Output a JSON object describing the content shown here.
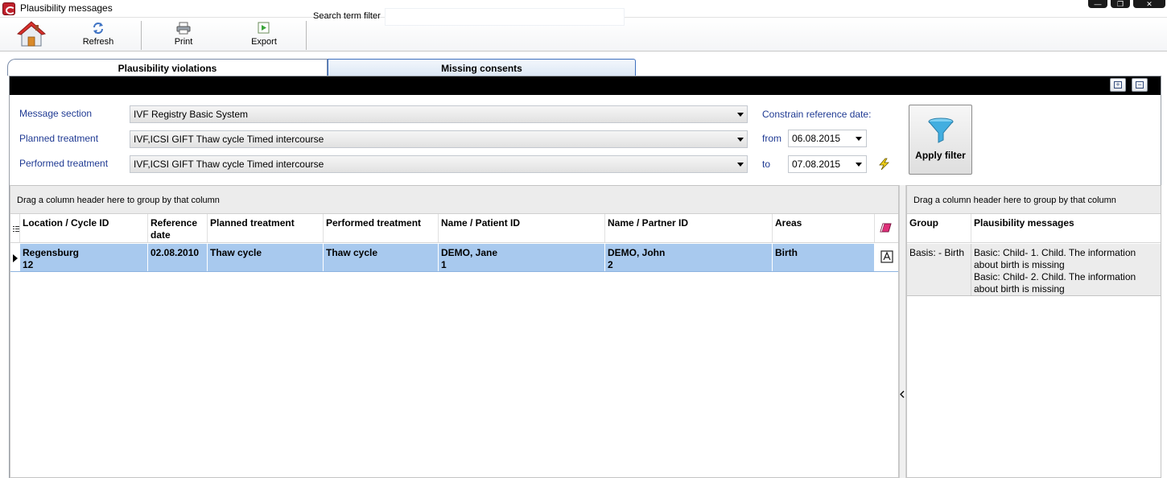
{
  "window": {
    "title": "Plausibility messages",
    "controls": [
      "—",
      "❐",
      "✕"
    ]
  },
  "toolbar": {
    "refresh_label": "Refresh",
    "print_label": "Print",
    "export_label": "Export",
    "search_label": "Search term filter",
    "search_value": ""
  },
  "tabs": [
    {
      "label": "Plausibility violations",
      "active": true
    },
    {
      "label": "Missing consents",
      "active": false
    }
  ],
  "panel": {
    "expand_symbol": "+",
    "collapse_symbol": "−"
  },
  "filters": {
    "message_section_label": "Message section",
    "message_section_value": "IVF Registry Basic System",
    "planned_label": "Planned treatment",
    "planned_value": "IVF,ICSI GIFT Thaw cycle Timed intercourse",
    "performed_label": "Performed treatment",
    "performed_value": "IVF,ICSI GIFT Thaw cycle Timed intercourse",
    "constrain_label": "Constrain reference date:",
    "from_label": "from",
    "from_value": "06.08.2015",
    "to_label": "to",
    "to_value": "07.08.2015",
    "apply_label": "Apply filter"
  },
  "left_grid": {
    "group_hint": "Drag a column header here to group by that column",
    "columns": [
      "Location / Cycle ID",
      "Reference date",
      "Planned treatment",
      "Performed treatment",
      "Name / Patient ID",
      "Name / Partner ID",
      "Areas"
    ],
    "rows": [
      {
        "location": "Regensburg",
        "cycle_id": "12",
        "reference_date": "02.08.2010",
        "planned": "Thaw cycle",
        "performed": "Thaw cycle",
        "patient_name": "DEMO, Jane",
        "patient_id": "1",
        "partner_name": "DEMO, John",
        "partner_id": "2",
        "areas": "Birth"
      }
    ]
  },
  "right_grid": {
    "group_hint": "Drag a column header here to group by that column",
    "columns": [
      "Group",
      "Plausibility messages"
    ],
    "rows": [
      {
        "group": "Basis: - Birth",
        "messages": [
          "Basic: Child- 1. Child. The information about birth is missing",
          "Basic: Child- 2. Child. The information about birth is missing"
        ]
      }
    ]
  },
  "colors": {
    "label_blue": "#1f3a93",
    "selected_row": "#a8c9ee",
    "header_bar": "#000000"
  }
}
